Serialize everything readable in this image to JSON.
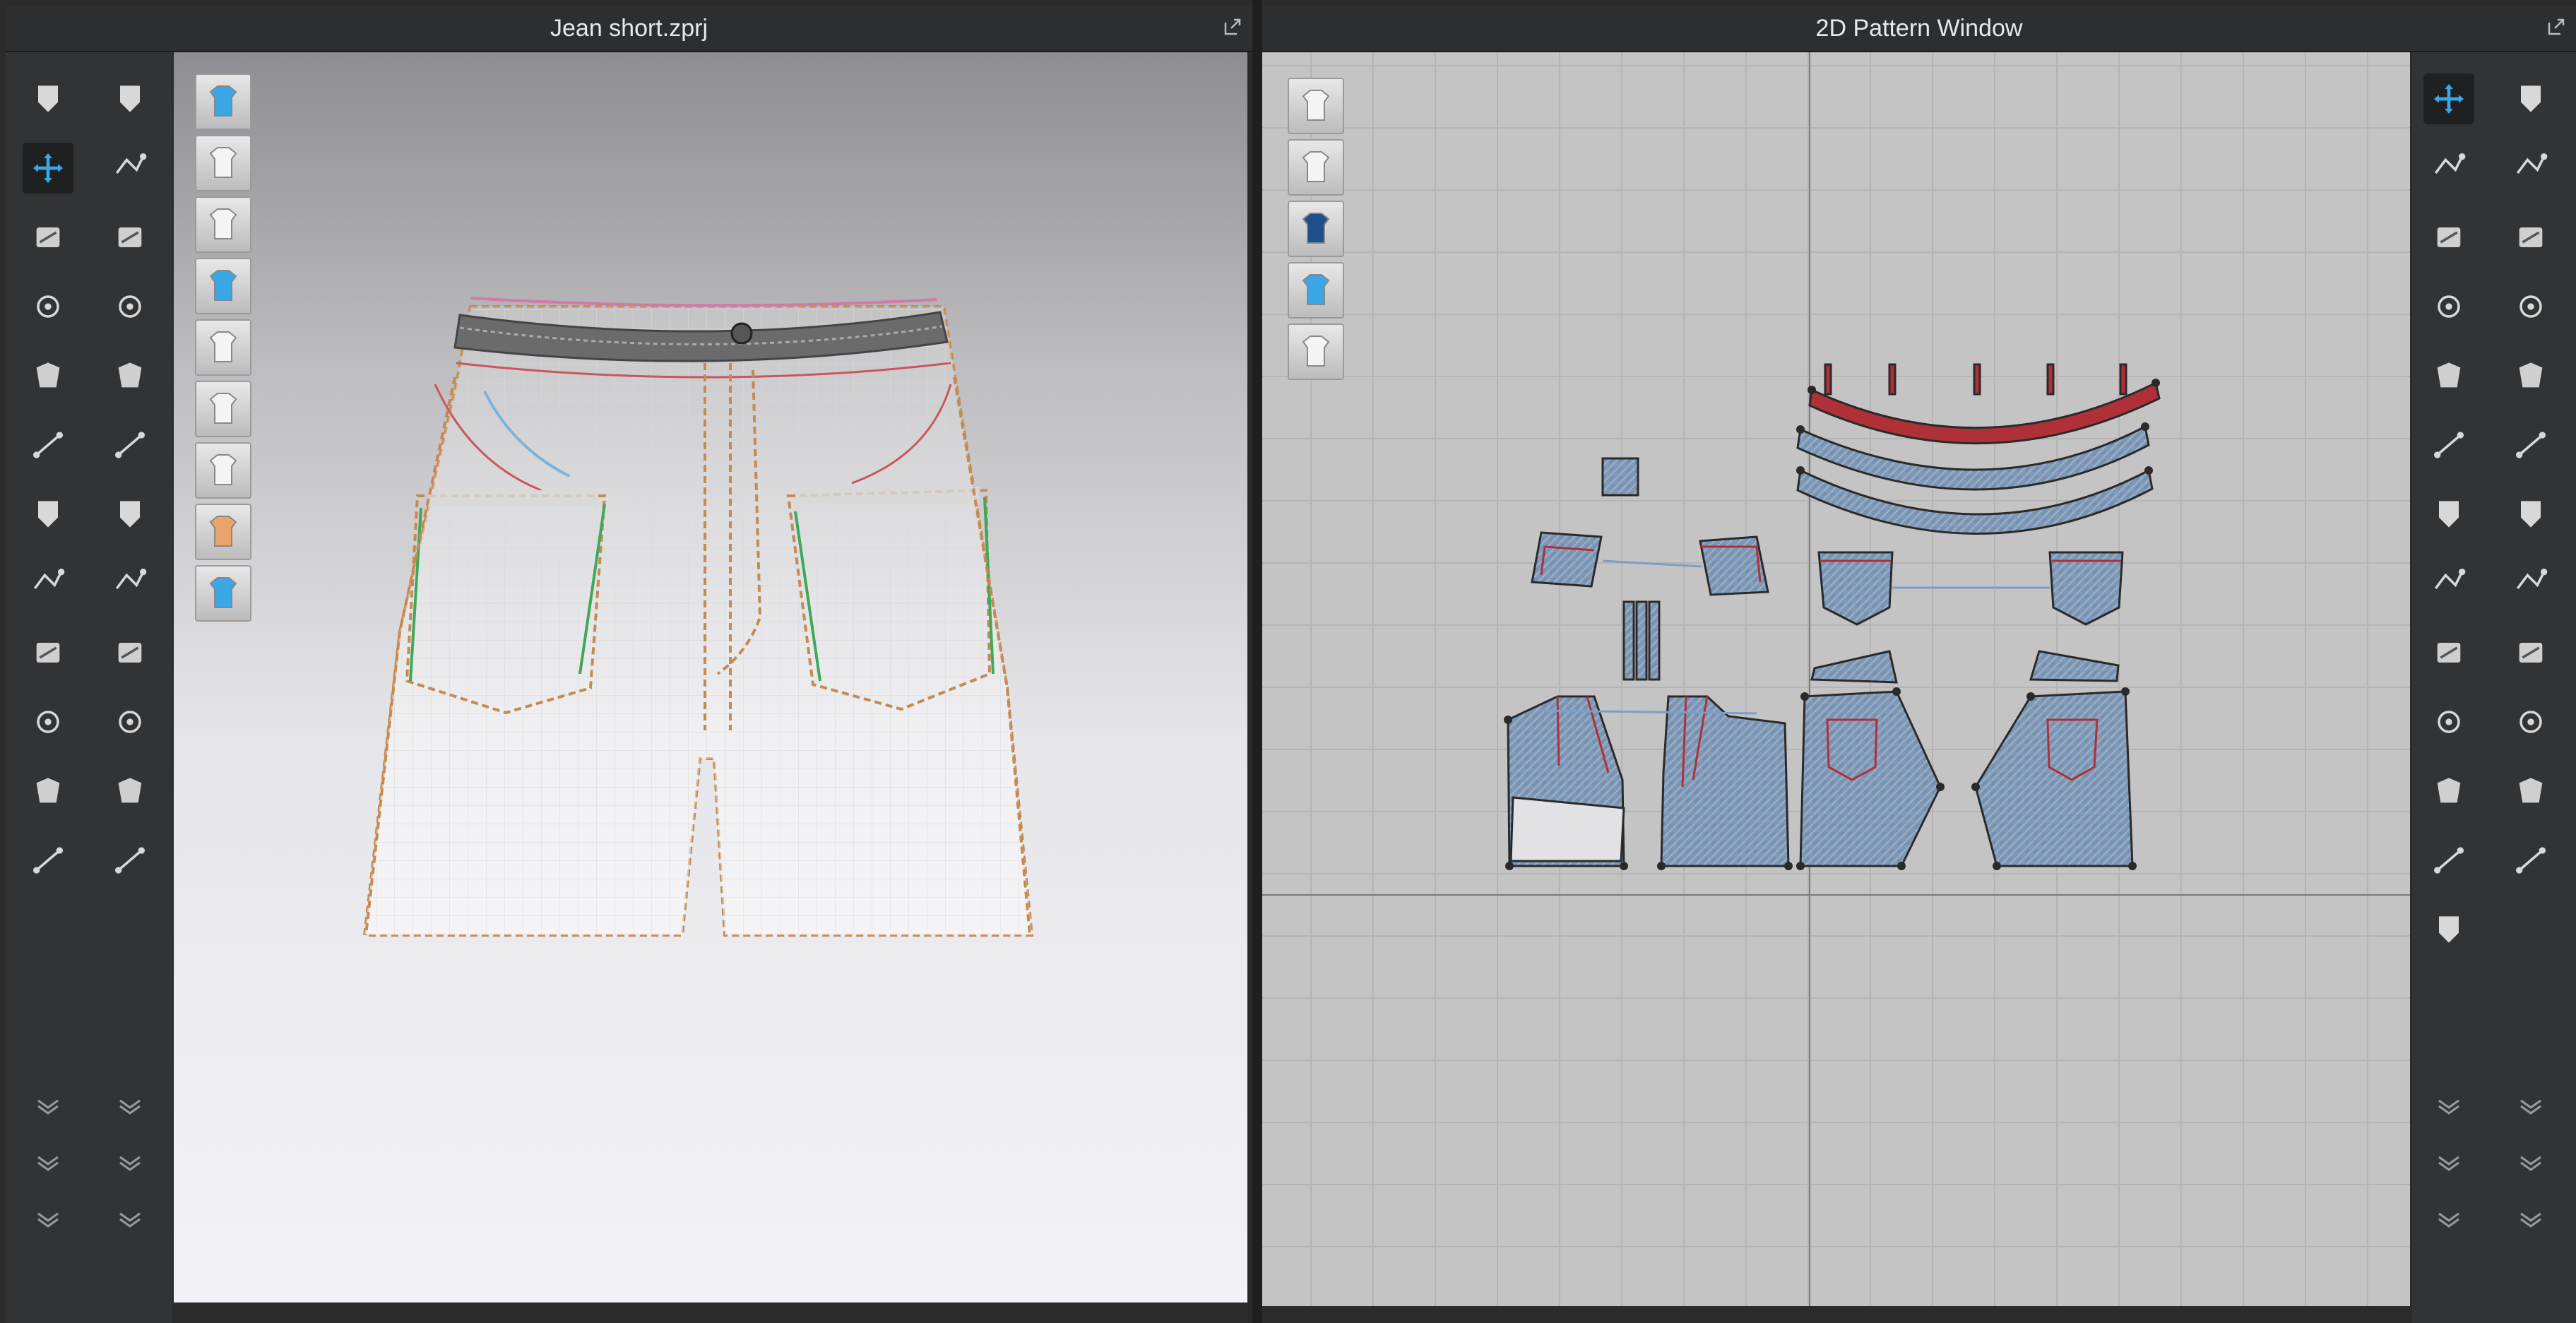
{
  "left_window": {
    "title": "Jean short.zprj",
    "toolbar_col1": [
      {
        "icon": "arrow-down-icon"
      },
      {
        "icon": "select-move-icon",
        "active": true
      },
      {
        "icon": "lasso-select-icon"
      },
      {
        "icon": "garment-select-icon"
      },
      {
        "icon": "transform-icon"
      },
      {
        "icon": "pin-icon"
      },
      {
        "icon": "tack-icon"
      },
      {
        "icon": "fold-arrange-icon"
      },
      {
        "icon": "measure-line-icon"
      },
      {
        "icon": "zipper-icon"
      },
      {
        "icon": "avatar-arrange-icon"
      },
      {
        "icon": "hanger-icon"
      }
    ],
    "toolbar_col2": [
      {
        "icon": "avatar-walk-icon"
      },
      {
        "icon": "edit-pattern-3d-icon"
      },
      {
        "icon": "segment-sew-icon"
      },
      {
        "icon": "free-sew-icon"
      },
      {
        "icon": "edit-sewing-icon"
      },
      {
        "icon": "strap-icon"
      },
      {
        "icon": "texture-3d-icon"
      },
      {
        "icon": "graphic-icon"
      },
      {
        "icon": "trim-icon"
      },
      {
        "icon": "button-icon"
      },
      {
        "icon": "buttonhole-icon"
      },
      {
        "icon": "lock-button-icon"
      }
    ],
    "viewport_tools": [
      "show-3d-garment-icon",
      "show-garment-icon",
      "show-clothing-icon",
      "show-texture-icon",
      "show-avatar-icon",
      "show-mesh-icon",
      "show-surface-icon",
      "show-skin-icon",
      "show-world-icon"
    ]
  },
  "right_window": {
    "title": "2D Pattern Window",
    "pattern_tools": [
      "show-baseline-icon",
      "show-pattern-icon",
      "info-icon",
      "show-texture-icon",
      "lock-pattern-icon"
    ],
    "toolbar_col1": [
      {
        "icon": "transform-pattern-icon",
        "active": true
      },
      {
        "icon": "edit-point-icon"
      },
      {
        "icon": "add-point-icon"
      },
      {
        "icon": "polygon-icon"
      },
      {
        "icon": "rectangle-icon"
      },
      {
        "icon": "internal-rectangle-icon"
      },
      {
        "icon": "dart-icon"
      },
      {
        "icon": "trace-icon"
      },
      {
        "icon": "cut-icon"
      },
      {
        "icon": "notch-icon"
      },
      {
        "icon": "ruler-icon"
      },
      {
        "icon": "tape-icon"
      },
      {
        "icon": "layer-stack-icon"
      }
    ],
    "toolbar_col2": [
      {
        "icon": "segment-sew-2d-icon"
      },
      {
        "icon": "curve-point-icon"
      },
      {
        "icon": "fold-icon"
      },
      {
        "icon": "zoom-fit-icon"
      },
      {
        "icon": "iron-icon"
      },
      {
        "icon": "shirt-icon"
      },
      {
        "icon": "texture-2d-icon"
      },
      {
        "icon": "graphic-2d-icon"
      },
      {
        "icon": "trim-2d-icon"
      },
      {
        "icon": "topstitch-icon"
      },
      {
        "icon": "puckering-icon"
      },
      {
        "icon": "puffer-icon"
      }
    ]
  },
  "colors": {
    "accent": "#3aa7e6",
    "seam_red": "#b03038",
    "denim": "#7f98b6",
    "window_bg": "#2d2e30",
    "pattern_bg": "#c4c4c4"
  }
}
